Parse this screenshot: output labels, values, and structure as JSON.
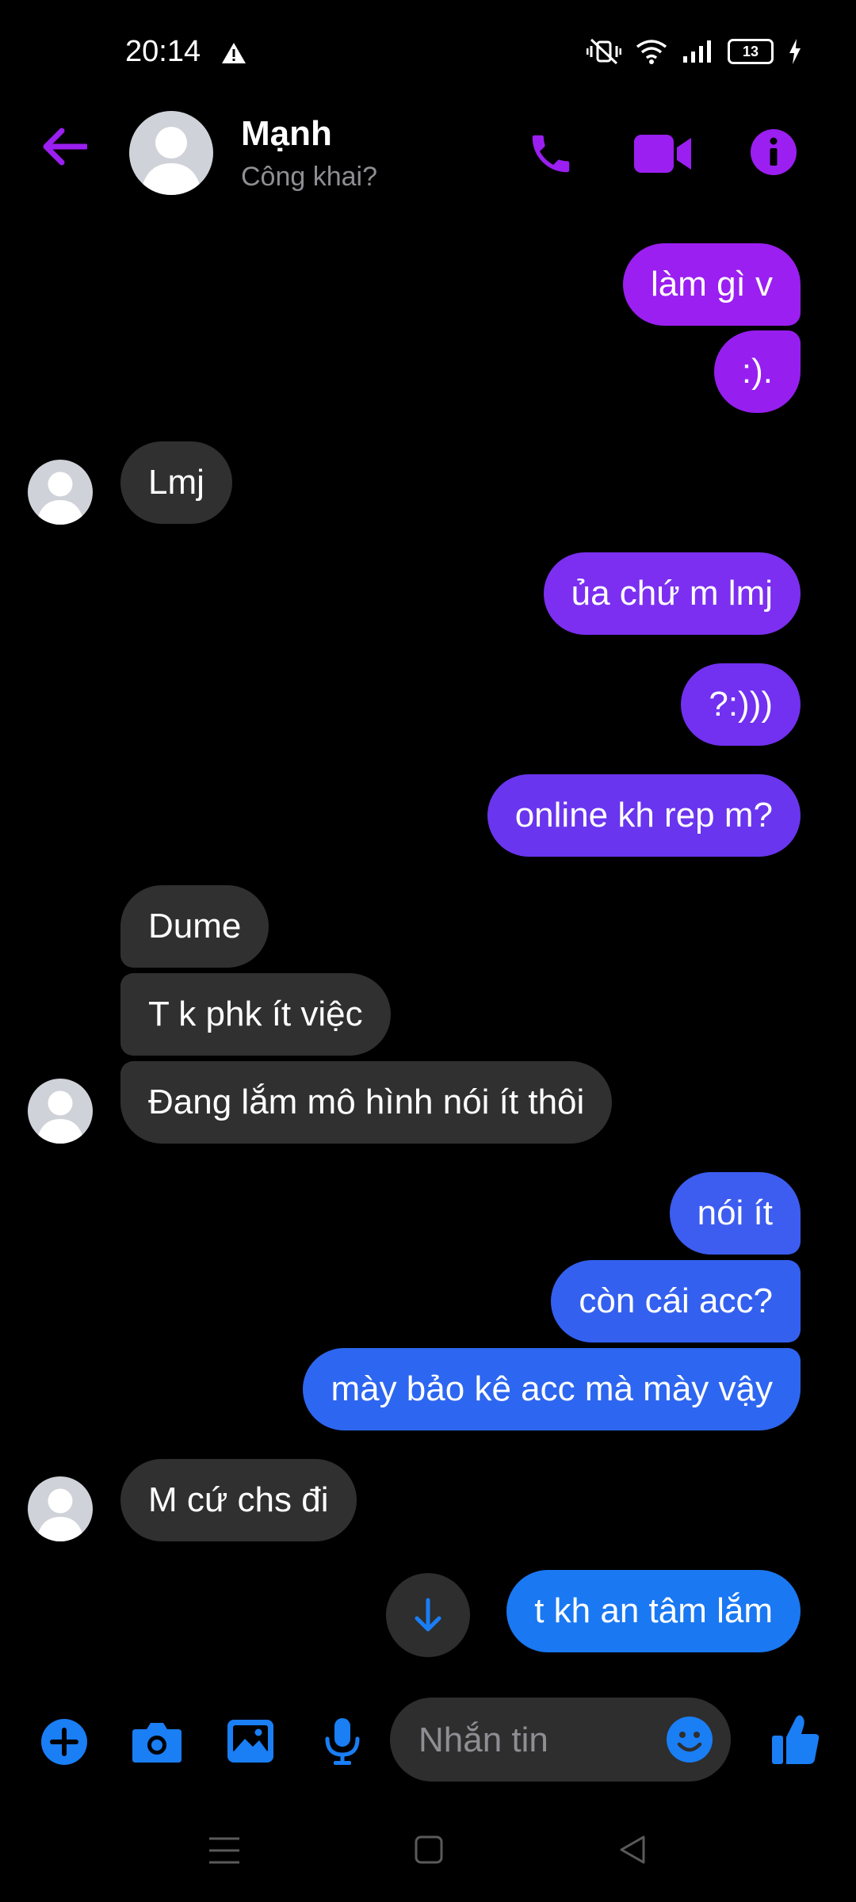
{
  "status_bar": {
    "time": "20:14",
    "battery": "13"
  },
  "header": {
    "contact_name": "Mạnh",
    "subtitle": "Công khai?"
  },
  "messages": [
    {
      "side": "out",
      "text": "làm gì v"
    },
    {
      "side": "out",
      "text": ":)."
    },
    {
      "side": "in",
      "text": "Lmj"
    },
    {
      "side": "out",
      "text": "ủa chứ m lmj"
    },
    {
      "side": "out",
      "text": "?:)))"
    },
    {
      "side": "out",
      "text": "online kh rep m?"
    },
    {
      "side": "in",
      "text": "Dume"
    },
    {
      "side": "in",
      "text": "T k phk ít việc"
    },
    {
      "side": "in",
      "text": "Đang lắm mô hình nói ít thôi"
    },
    {
      "side": "out",
      "text": "nói ít"
    },
    {
      "side": "out",
      "text": "còn cái acc?"
    },
    {
      "side": "out",
      "text": "mày bảo kê acc mà mày vậy"
    },
    {
      "side": "in",
      "text": "M cứ chs đi"
    },
    {
      "side": "out",
      "text": "t kh an tâm lắm"
    }
  ],
  "composer": {
    "placeholder": "Nhắn tin"
  },
  "colors": {
    "accent_purple": "#9b1ff0",
    "send_icon_blue": "#1a7ef5",
    "incoming_bubble": "#303030",
    "background": "#000000"
  },
  "icons": [
    "back-arrow-icon",
    "phone-icon",
    "video-icon",
    "info-icon",
    "plus-icon",
    "camera-icon",
    "gallery-icon",
    "mic-icon",
    "emoji-icon",
    "thumbs-up-icon",
    "arrow-down-icon"
  ]
}
